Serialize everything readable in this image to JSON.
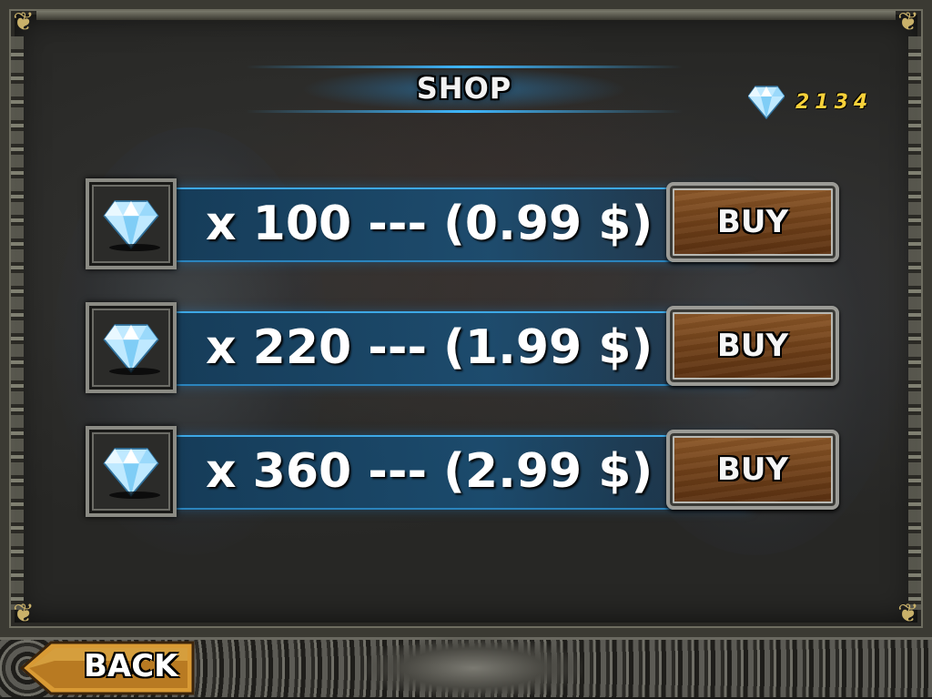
{
  "header": {
    "title": "SHOP"
  },
  "balance": {
    "icon": "diamond-icon",
    "value": "2134"
  },
  "offers": [
    {
      "icon": "diamond-icon",
      "label": "x 100 --- (0.99 $)",
      "button_label": "BUY"
    },
    {
      "icon": "diamond-icon",
      "label": "x 220 --- (1.99 $)",
      "button_label": "BUY"
    },
    {
      "icon": "diamond-icon",
      "label": "x 360 --- (2.99 $)",
      "button_label": "BUY"
    }
  ],
  "footer": {
    "back_label": "BACK"
  },
  "colors": {
    "accent_blue": "#3fb8ff",
    "balance_gold": "#f7d13a",
    "button_wood": "#7a4a1f",
    "back_gold": "#e8a33a"
  }
}
